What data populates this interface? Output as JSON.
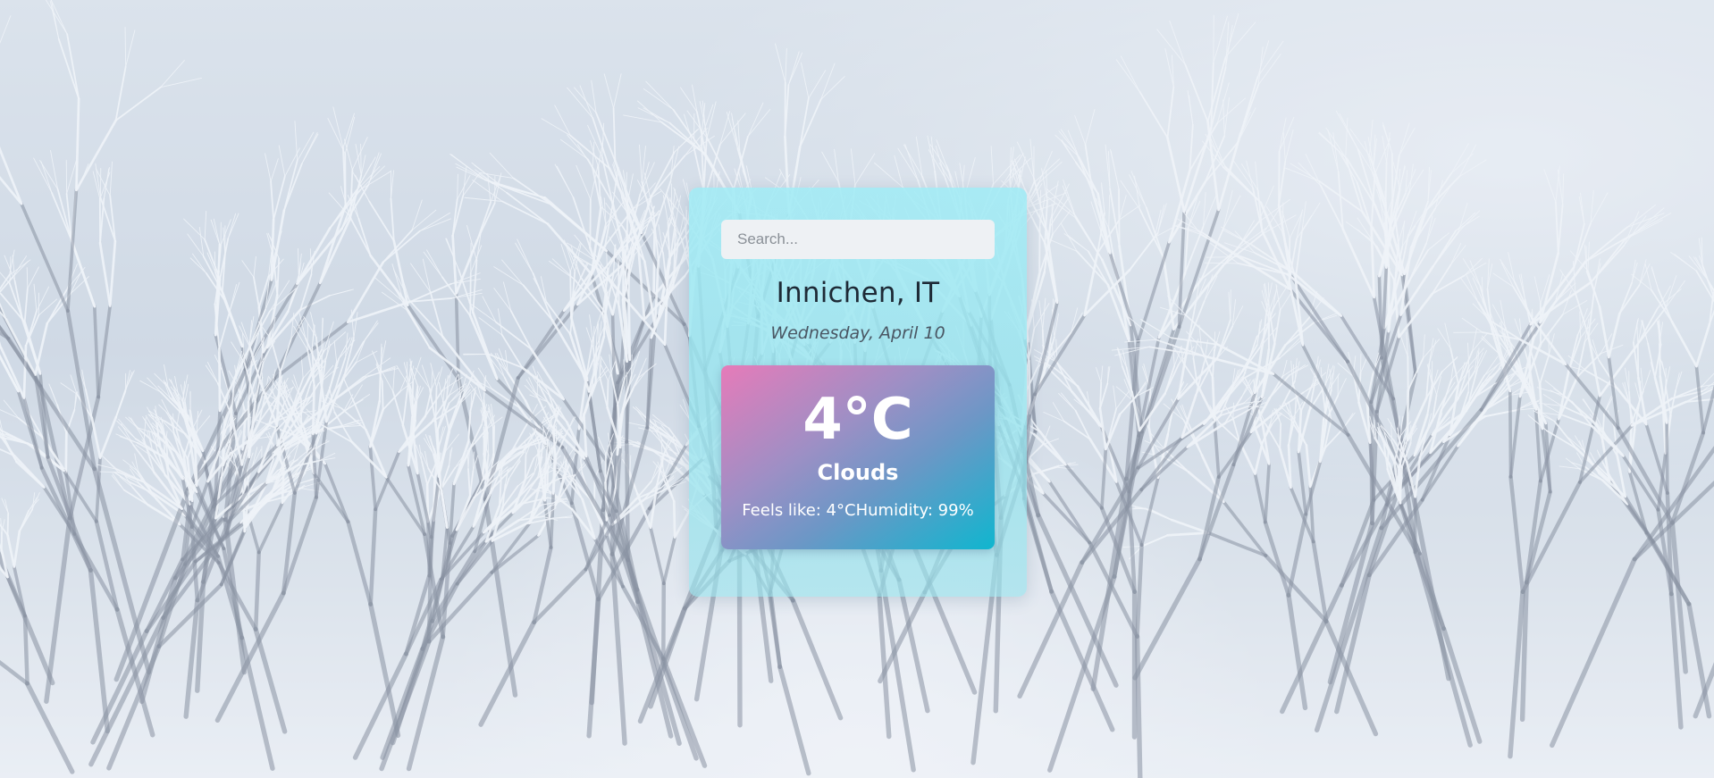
{
  "search": {
    "placeholder": "Search...",
    "value": ""
  },
  "location": {
    "city": "Innichen, IT",
    "date": "Wednesday, April 10"
  },
  "weather": {
    "temperature": "4°C",
    "condition": "Clouds",
    "feels_like": "Feels like: 4°C",
    "humidity": "Humidity: 99%"
  },
  "colors": {
    "card_accent": "#a0ebf5",
    "gradient_start": "#e67bb9",
    "gradient_end": "#0fb6cf",
    "text_dark": "#1e2a36"
  }
}
